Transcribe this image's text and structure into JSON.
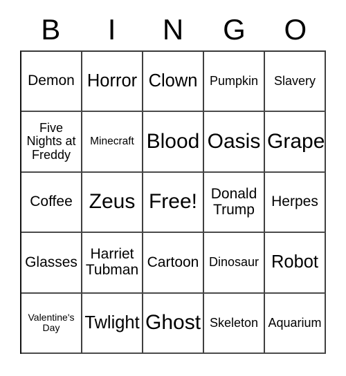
{
  "card": {
    "header_letters": [
      "B",
      "I",
      "N",
      "G",
      "O"
    ],
    "rows": [
      [
        {
          "label": "Demon",
          "size": "l"
        },
        {
          "label": "Horror",
          "size": "xl"
        },
        {
          "label": "Clown",
          "size": "xl"
        },
        {
          "label": "Pumpkin",
          "size": "m"
        },
        {
          "label": "Slavery",
          "size": "m"
        }
      ],
      [
        {
          "label": "Five Nights at Freddy",
          "size": "m"
        },
        {
          "label": "Minecraft",
          "size": "s"
        },
        {
          "label": "Blood",
          "size": "xxl"
        },
        {
          "label": "Oasis",
          "size": "xxl"
        },
        {
          "label": "Grape",
          "size": "xxl"
        }
      ],
      [
        {
          "label": "Coffee",
          "size": "l"
        },
        {
          "label": "Zeus",
          "size": "xxl"
        },
        {
          "label": "Free!",
          "size": "xxl"
        },
        {
          "label": "Donald Trump",
          "size": "l"
        },
        {
          "label": "Herpes",
          "size": "l"
        }
      ],
      [
        {
          "label": "Glasses",
          "size": "l"
        },
        {
          "label": "Harriet Tubman",
          "size": "l"
        },
        {
          "label": "Cartoon",
          "size": "l"
        },
        {
          "label": "Dinosaur",
          "size": "m"
        },
        {
          "label": "Robot",
          "size": "xl"
        }
      ],
      [
        {
          "label": "Valentine's Day",
          "size": "xs"
        },
        {
          "label": "Twlight",
          "size": "xl"
        },
        {
          "label": "Ghost",
          "size": "xxl"
        },
        {
          "label": "Skeleton",
          "size": "m"
        },
        {
          "label": "Aquarium",
          "size": "m"
        }
      ]
    ]
  }
}
